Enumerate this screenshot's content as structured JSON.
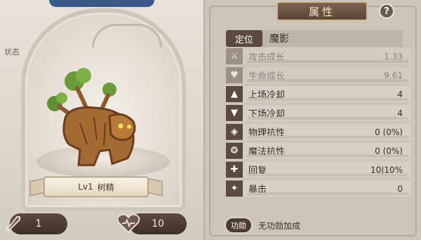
{
  "left": {
    "status_tag": "状态",
    "name_level": "Lv1",
    "name": "树精",
    "attack_value": "1",
    "hp_value": "10"
  },
  "right": {
    "title": "属性",
    "help": "?",
    "role_label": "定位",
    "role_value": "魔影",
    "rows": [
      {
        "label": "攻击成长",
        "value": "1.33",
        "icon": "sword-icon",
        "faded": true
      },
      {
        "label": "生命成长",
        "value": "9.61",
        "icon": "heart-icon",
        "faded": true
      },
      {
        "label": "上场冷却",
        "value": "4",
        "icon": "up-arrow-icon",
        "faded": false
      },
      {
        "label": "下场冷却",
        "value": "4",
        "icon": "down-arrow-icon",
        "faded": false
      },
      {
        "label": "物理抗性",
        "value": "0 (0%)",
        "icon": "physical-shield-icon",
        "faded": false
      },
      {
        "label": "魔法抗性",
        "value": "0 (0%)",
        "icon": "magic-shield-icon",
        "faded": false
      },
      {
        "label": "回复",
        "value": "10|10%",
        "icon": "plus-icon",
        "faded": false
      },
      {
        "label": "暴击",
        "value": "0",
        "icon": "claw-icon",
        "faded": false
      }
    ],
    "skill_badge": "功勋",
    "skill_text": "无功勋加成"
  },
  "colors": {
    "accent_dark": "#5b4a3f",
    "banner_gold": "#d6b98a",
    "panel_bg": "#ccc5bc"
  }
}
